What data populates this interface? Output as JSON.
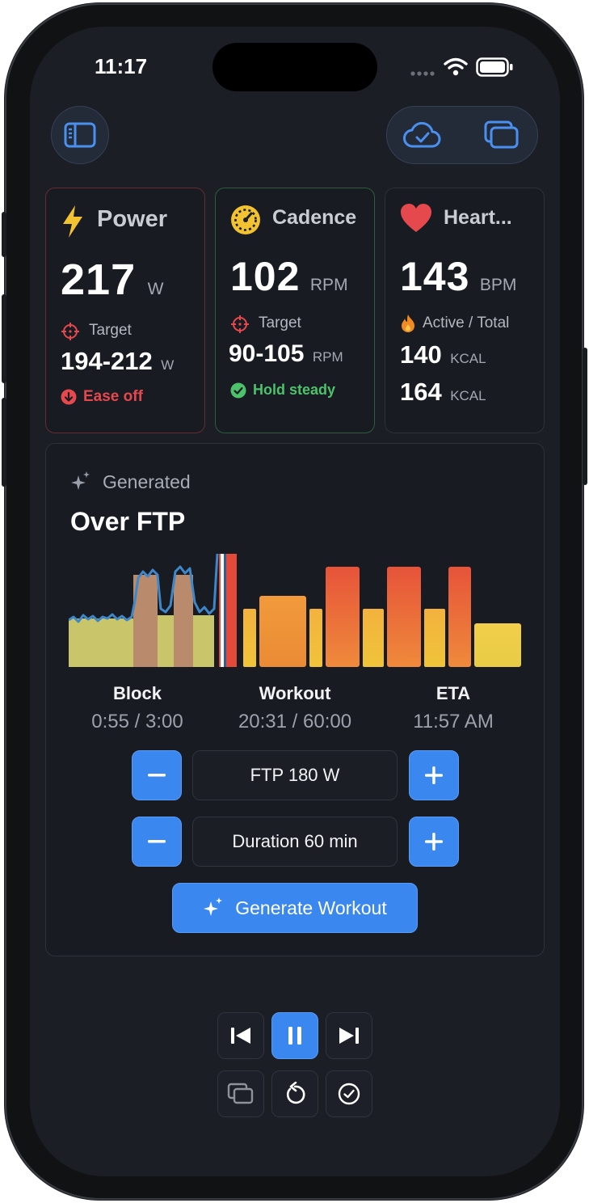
{
  "status_bar": {
    "time": "11:17"
  },
  "metrics": {
    "power": {
      "title": "Power",
      "value": "217",
      "unit": "W",
      "target_label": "Target",
      "target_value": "194-212",
      "target_unit": "W",
      "hint": "Ease off",
      "hint_color": "#e5484d"
    },
    "cadence": {
      "title": "Cadence",
      "value": "102",
      "unit": "RPM",
      "target_label": "Target",
      "target_value": "90-105",
      "target_unit": "RPM",
      "hint": "Hold steady",
      "hint_color": "#4cc26b"
    },
    "heart": {
      "title": "Heart...",
      "value": "143",
      "unit": "BPM",
      "energy_label": "Active / Total",
      "active_value": "140",
      "active_unit": "KCAL",
      "total_value": "164",
      "total_unit": "KCAL"
    }
  },
  "workout": {
    "generated_label": "Generated",
    "title": "Over FTP",
    "block_label": "Block",
    "block_value": "0:55 / 3:00",
    "workout_label": "Workout",
    "workout_value": "20:31 / 60:00",
    "eta_label": "ETA",
    "eta_value": "11:57 AM",
    "ftp_label": "FTP 180 W",
    "duration_label": "Duration 60 min",
    "generate_label": "Generate Workout"
  },
  "colors": {
    "accent": "#3a87f0",
    "background": "#1b1e25",
    "card": "#181b21",
    "power_border": "#6b2a2e",
    "cadence_border": "#2b5e3a"
  },
  "icons": {
    "sidebar": "sidebar-icon",
    "cloud": "cloud-check-icon",
    "windows": "windows-icon",
    "bolt": "lightning-bolt-icon",
    "gauge": "gauge-icon",
    "heart": "heart-icon",
    "target": "crosshair-icon",
    "flame": "flame-icon",
    "sparkles": "sparkles-icon",
    "prev": "skip-back-icon",
    "pause": "pause-icon",
    "next": "skip-forward-icon",
    "restart": "restart-icon",
    "complete": "checkmark-circle-icon"
  }
}
